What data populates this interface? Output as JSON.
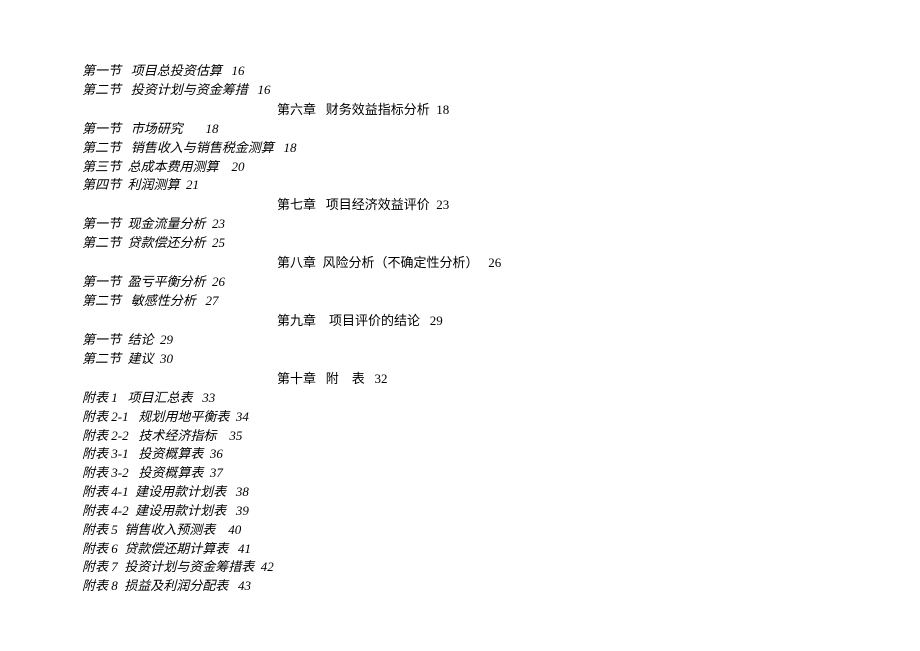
{
  "lines": [
    {
      "type": "section",
      "text": "第一节   项目总投资估算   16"
    },
    {
      "type": "section",
      "text": "第二节   投资计划与资金筹措   16"
    },
    {
      "type": "chapter",
      "text": "第六章   财务效益指标分析  18"
    },
    {
      "type": "section",
      "text": "第一节   市场研究       18"
    },
    {
      "type": "section",
      "text": "第二节   销售收入与销售税金测算   18"
    },
    {
      "type": "section",
      "text": "第三节  总成本费用测算    20"
    },
    {
      "type": "section",
      "text": "第四节  利润测算  21"
    },
    {
      "type": "chapter",
      "text": "第七章   项目经济效益评价  23"
    },
    {
      "type": "section",
      "text": "第一节  现金流量分析  23"
    },
    {
      "type": "section",
      "text": "第二节  贷款偿还分析  25"
    },
    {
      "type": "chapter",
      "text": "第八章  风险分析（不确定性分析）   26"
    },
    {
      "type": "section",
      "text": "第一节  盈亏平衡分析  26"
    },
    {
      "type": "section",
      "text": "第二节   敏感性分析   27"
    },
    {
      "type": "chapter",
      "text": "第九章    项目评价的结论   29"
    },
    {
      "type": "section",
      "text": "第一节  结论  29"
    },
    {
      "type": "section",
      "text": "第二节  建议  30"
    },
    {
      "type": "chapter",
      "text": "第十章   附    表   32"
    },
    {
      "type": "section",
      "text": "附表 1   项目汇总表   33"
    },
    {
      "type": "section",
      "text": "附表 2-1   规划用地平衡表  34"
    },
    {
      "type": "section",
      "text": "附表 2-2   技术经济指标    35"
    },
    {
      "type": "section",
      "text": "附表 3-1   投资概算表  36"
    },
    {
      "type": "section",
      "text": "附表 3-2   投资概算表  37"
    },
    {
      "type": "section",
      "text": "附表 4-1  建设用款计划表   38"
    },
    {
      "type": "section",
      "text": "附表 4-2  建设用款计划表   39"
    },
    {
      "type": "section",
      "text": "附表 5  销售收入预测表    40"
    },
    {
      "type": "section",
      "text": "附表 6  贷款偿还期计算表   41"
    },
    {
      "type": "section",
      "text": "附表 7  投资计划与资金筹措表  42"
    },
    {
      "type": "section",
      "text": "附表 8  损益及利润分配表   43"
    }
  ]
}
